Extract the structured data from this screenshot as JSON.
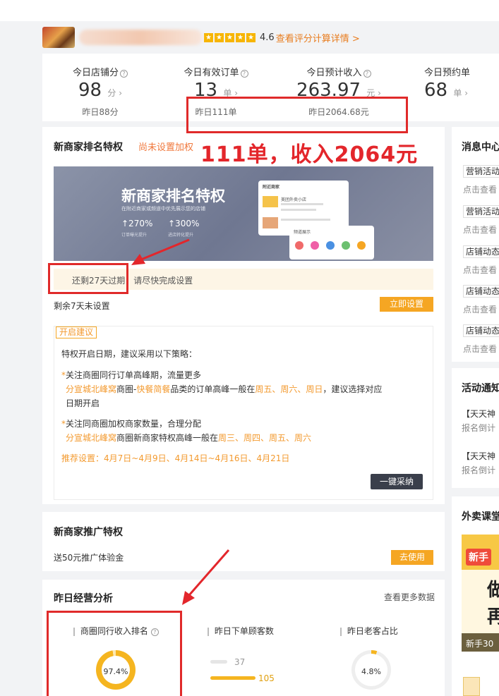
{
  "shop": {
    "score": "4.6",
    "score_link": "查看评分计算详情 >",
    "stars": [
      "★",
      "★",
      "★",
      "★",
      "★"
    ]
  },
  "stats": [
    {
      "title": "今日店铺分",
      "value": "98",
      "unit": "分",
      "yesterday": "昨日88分"
    },
    {
      "title": "今日有效订单",
      "value": "13",
      "unit": "单",
      "yesterday": "昨日111单"
    },
    {
      "title": "今日预计收入",
      "value": "263.97",
      "unit": "元",
      "yesterday": "昨日2064.68元"
    },
    {
      "title": "今日预约单",
      "value": "68",
      "unit": "单",
      "yesterday": ""
    }
  ],
  "annotation": "111单，收入2064元",
  "ranking": {
    "title": "新商家排名特权",
    "status": "尚未设置加权",
    "banner_title": "新商家排名特权",
    "banner_sub": "在附近商家或频道中优先展示您的店铺",
    "banner_stat1": "↑270%",
    "banner_stat1_label": "订单曝光提升",
    "banner_stat2": "↑300%",
    "banner_stat2_label": "进店转化提升",
    "mock_header": "附近商家",
    "mock_shop": "美团外卖小店",
    "mock_channel": "频道展示",
    "expire_notice": "还剩27天过期，请尽快完成设置",
    "remain": "剩余7天未设置",
    "set_button": "立即设置",
    "advice_tag": "开启建议",
    "advice_intro": "特权开启日期，建议采用以下策略：",
    "tip1_title": "关注商圈同行订单高峰期，流量更多",
    "tip1_area": "分宣城北峰窝",
    "tip1_mid": "商圈-",
    "tip1_cat": "快餐简餐",
    "tip1_rest": "品类的订单高峰一般在",
    "tip1_days": "周五、周六、周日",
    "tip1_end": "，建议选择对应",
    "tip1_end2": "日期开启",
    "tip2_title": "关注同商圈加权商家数量，合理分配",
    "tip2_area": "分宣城北峰窝",
    "tip2_rest": "商圈新商家特权高峰一般在",
    "tip2_days": "周三、周四、周五、周六",
    "recommend": "推荐设置：4月7日~4月9日、4月14日~4月16日、4月21日",
    "adopt_button": "一键采纳"
  },
  "promo": {
    "title": "新商家推广特权",
    "text": "送50元推广体验金",
    "button": "去使用"
  },
  "analysis": {
    "title": "昨日经营分析",
    "more": "查看更多数据",
    "m1_title": "商圈同行收入排名",
    "m1_value": "97.4%",
    "m1_fraction": 0.974,
    "m2_title": "昨日下单顾客数",
    "m2_a": "37",
    "m2_b": "105",
    "m3_title": "昨日老客占比",
    "m3_value": "4.8%",
    "m3_fraction": 0.048
  },
  "right": {
    "msg_title": "消息中心",
    "tags": [
      "营销活动",
      "营销活动",
      "店铺动态",
      "店铺动态",
      "店铺动态"
    ],
    "tag_sub": "点击查看",
    "act_title": "活动通知",
    "act1": "【天天神",
    "act1_sub": "报名倒计",
    "act2": "【天天神",
    "act2_sub": "报名倒计",
    "course_title": "外卖课堂",
    "course_badge": "新手",
    "course_big1": "做",
    "course_big2": "再",
    "course_foot": "新手30"
  },
  "colors": {
    "accent_orange": "#f5a623",
    "annotation_red": "#e3262b",
    "dark_button": "#3a3f4b"
  }
}
